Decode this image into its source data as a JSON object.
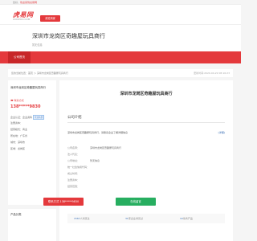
{
  "topbar": {
    "text_prefix": "您好，",
    "text_link": "欢迎来到虎易网"
  },
  "logo": {
    "cn": "虎易网",
    "en": "COOVOO.COM"
  },
  "header": {
    "button_label": "浏览商家"
  },
  "company": {
    "name": "深圳市龙岗区奇趣屋玩具商行",
    "subtitle": "暂无信息"
  },
  "nav": {
    "items": [
      "公司首页"
    ]
  },
  "breadcrumb": {
    "text": "您的当前位置：首页 ＞ 深圳市龙岗区奇趣屋玩具商行",
    "updated": "更新时间:2020-04-22 08:16:23"
  },
  "sidebar": {
    "company_name": "深圳市龙岗区奇趣屋玩具商行",
    "contact_label": "联系方式",
    "phone": "138*****9830",
    "rows": [
      {
        "label": "企业认证：",
        "value": "企业资料",
        "tag": "营业执照"
      },
      {
        "label": "注册资本：",
        "value": ""
      },
      {
        "label": "经营模式：",
        "value": "商业"
      },
      {
        "label": "所在地：",
        "value": "广东省"
      },
      {
        "label": "城市：",
        "value": "深圳市"
      },
      {
        "label": "区域：",
        "value": "龙岗区"
      }
    ],
    "products_title": "产品分类"
  },
  "main": {
    "title": "深圳市龙岗区奇趣屋玩具商行",
    "intro_heading": "公司介绍",
    "desc": "深圳市龙岗区奇趣屋玩具商行，请联系企业了解详细信息",
    "more": "[详细]",
    "info": [
      {
        "label": "公司名称：",
        "value": "深圳市龙岗区奇趣屋玩具商行"
      },
      {
        "label": "法人代表：",
        "value": ""
      },
      {
        "label": "公司地址：",
        "value": "暂无信息"
      },
      {
        "label": "统一社会信用代码：",
        "value": ""
      },
      {
        "label": "成立时间：",
        "value": ""
      },
      {
        "label": "注册资本：",
        "value": ""
      },
      {
        "label": "经营范围：",
        "value": ""
      }
    ],
    "contact_button": "联系方式 138*****9830",
    "online_button": "在线留言",
    "stats": [
      {
        "num": "1567",
        "label": "人浏览过"
      },
      {
        "num": "31",
        "label": "家企业浏览过"
      },
      {
        "num": "10",
        "label": "条商产品"
      }
    ]
  },
  "colors": {
    "brand": "#e4393c",
    "link": "#3a6fb5",
    "online": "#27ae60"
  }
}
